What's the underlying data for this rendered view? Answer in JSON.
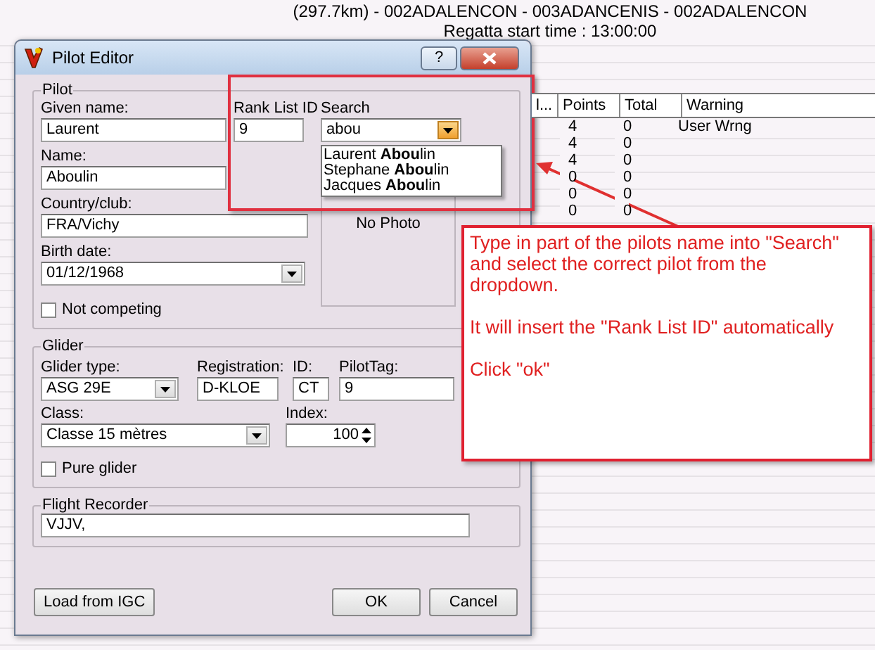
{
  "background": {
    "route": "(297.7km) - 002ADALENCON - 003ADANCENIS - 002ADALENCON",
    "start_time": "Regatta start time :  13:00:00",
    "table": {
      "columns": [
        "l...",
        "Points",
        "Total",
        "Warning"
      ],
      "rows": [
        {
          "points": "4",
          "total": "0",
          "warning": "User Wrng"
        },
        {
          "points": "4",
          "total": "0"
        },
        {
          "points": "4",
          "total": "0"
        },
        {
          "points": "0",
          "total": "0"
        },
        {
          "points": "0",
          "total": "0"
        },
        {
          "points": "0",
          "total": "0"
        }
      ]
    }
  },
  "dialog": {
    "title": "Pilot Editor",
    "help": "?",
    "pilot": {
      "legend": "Pilot",
      "given_name": {
        "label": "Given name:",
        "value": "Laurent"
      },
      "name": {
        "label": "Name:",
        "value": "Aboulin"
      },
      "country": {
        "label": "Country/club:",
        "value": "FRA/Vichy"
      },
      "birth_date": {
        "label": "Birth date:",
        "value": "01/12/1968"
      },
      "not_competing": {
        "label": "Not competing",
        "checked": false
      },
      "rank_list_id": {
        "label": "Rank List ID",
        "value": "9"
      },
      "search": {
        "label": "Search",
        "value": "abou",
        "expanded": true,
        "options": [
          "Laurent **Abou**lin",
          "Stephane **Abou**lin",
          "Jacques **Abou**lin"
        ]
      },
      "photo": "No Photo"
    },
    "glider": {
      "legend": "Glider",
      "glider_type": {
        "label": "Glider type:",
        "value": "ASG 29E"
      },
      "registration": {
        "label": "Registration:",
        "value": "D-KLOE"
      },
      "id": {
        "label": "ID:",
        "value": "CT"
      },
      "pilot_tag": {
        "label": "PilotTag:",
        "value": "9"
      },
      "class": {
        "label": "Class:",
        "value": "Classe 15 mètres"
      },
      "index": {
        "label": "Index:",
        "value": "100"
      },
      "pure_glider": {
        "label": "Pure glider",
        "checked": false
      }
    },
    "flight_recorder": {
      "legend": "Flight Recorder",
      "value": "VJJV,"
    },
    "buttons": {
      "load": "Load from IGC",
      "ok": "OK",
      "cancel": "Cancel"
    }
  },
  "callout": {
    "paragraphs": [
      "Type in part of the pilots name into \"Search\" and select the correct pilot from the dropdown.",
      "It will insert the \"Rank List ID\" automatically",
      "Click \"ok\""
    ]
  }
}
